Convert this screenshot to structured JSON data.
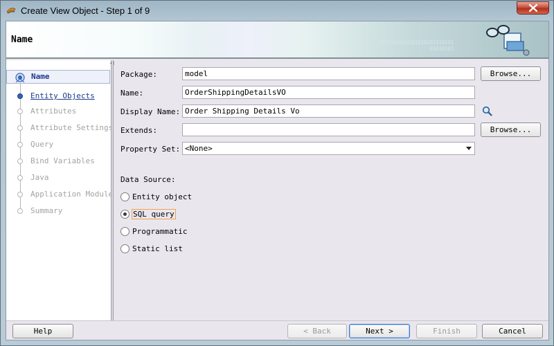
{
  "window": {
    "title": "Create View Object - Step 1 of 9"
  },
  "banner": {
    "title": "Name",
    "binary_text": "0010101010101010101010101\n01010101"
  },
  "steps": [
    {
      "label": "Name",
      "state": "active"
    },
    {
      "label": "Entity Objects",
      "state": "linked"
    },
    {
      "label": "Attributes",
      "state": "disabled"
    },
    {
      "label": "Attribute Settings",
      "state": "disabled"
    },
    {
      "label": "Query",
      "state": "disabled"
    },
    {
      "label": "Bind Variables",
      "state": "disabled"
    },
    {
      "label": "Java",
      "state": "disabled"
    },
    {
      "label": "Application Module",
      "state": "disabled"
    },
    {
      "label": "Summary",
      "state": "disabled"
    }
  ],
  "form": {
    "package_label": "Package:",
    "package_value": "model",
    "name_label": "Name:",
    "name_value": "OrderShippingDetailsVO",
    "display_name_label": "Display Name:",
    "display_name_value": "Order Shipping Details Vo",
    "extends_label": "Extends:",
    "extends_value": "",
    "property_set_label": "Property Set:",
    "property_set_value": "<None>",
    "browse_label": "Browse...",
    "data_source_label": "Data Source:",
    "data_sources": [
      {
        "label": "Entity object",
        "checked": false
      },
      {
        "label": "SQL query",
        "checked": true
      },
      {
        "label": "Programmatic",
        "checked": false
      },
      {
        "label": "Static list",
        "checked": false
      }
    ]
  },
  "footer": {
    "help": "Help",
    "back": "< Back",
    "next": "Next >",
    "finish": "Finish",
    "cancel": "Cancel"
  },
  "colors": {
    "link": "#1b3a8a",
    "focus_outline": "#f0a347",
    "close_button": "#c7503d"
  }
}
